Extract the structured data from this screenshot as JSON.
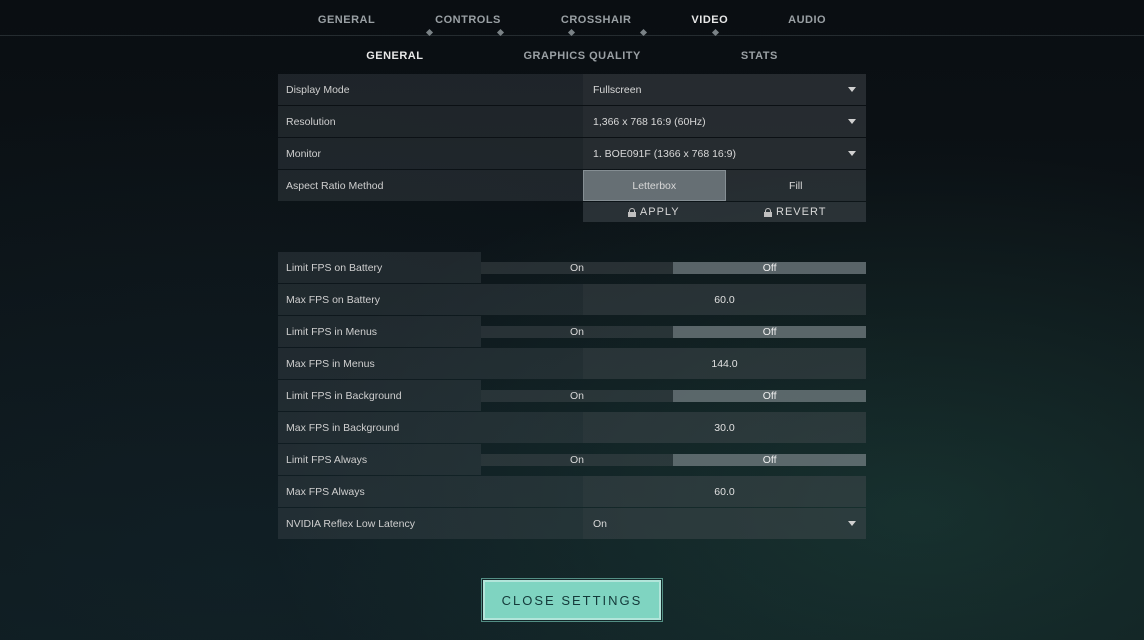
{
  "top_tabs": {
    "general": "GENERAL",
    "controls": "CONTROLS",
    "crosshair": "CROSSHAIR",
    "video": "VIDEO",
    "audio": "AUDIO"
  },
  "sub_tabs": {
    "general": "GENERAL",
    "graphics_quality": "GRAPHICS QUALITY",
    "stats": "STATS"
  },
  "labels": {
    "display_mode": "Display Mode",
    "resolution": "Resolution",
    "monitor": "Monitor",
    "aspect_ratio_method": "Aspect Ratio Method",
    "limit_fps_battery": "Limit FPS on Battery",
    "max_fps_battery": "Max FPS on Battery",
    "limit_fps_menus": "Limit FPS in Menus",
    "max_fps_menus": "Max FPS in Menus",
    "limit_fps_background": "Limit FPS in Background",
    "max_fps_background": "Max FPS in Background",
    "limit_fps_always": "Limit FPS Always",
    "max_fps_always": "Max FPS Always",
    "nvidia_reflex": "NVIDIA Reflex Low Latency"
  },
  "values": {
    "display_mode": "Fullscreen",
    "resolution": "1,366 x 768 16:9 (60Hz)",
    "monitor": "1. BOE091F (1366 x  768 16:9)",
    "nvidia_reflex": "On",
    "max_fps_battery": "60.0",
    "max_fps_menus": "144.0",
    "max_fps_background": "30.0",
    "max_fps_always": "60.0"
  },
  "buttons": {
    "on": "On",
    "off": "Off",
    "letterbox": "Letterbox",
    "fill": "Fill",
    "apply": "APPLY",
    "revert": "REVERT",
    "close": "CLOSE SETTINGS"
  }
}
